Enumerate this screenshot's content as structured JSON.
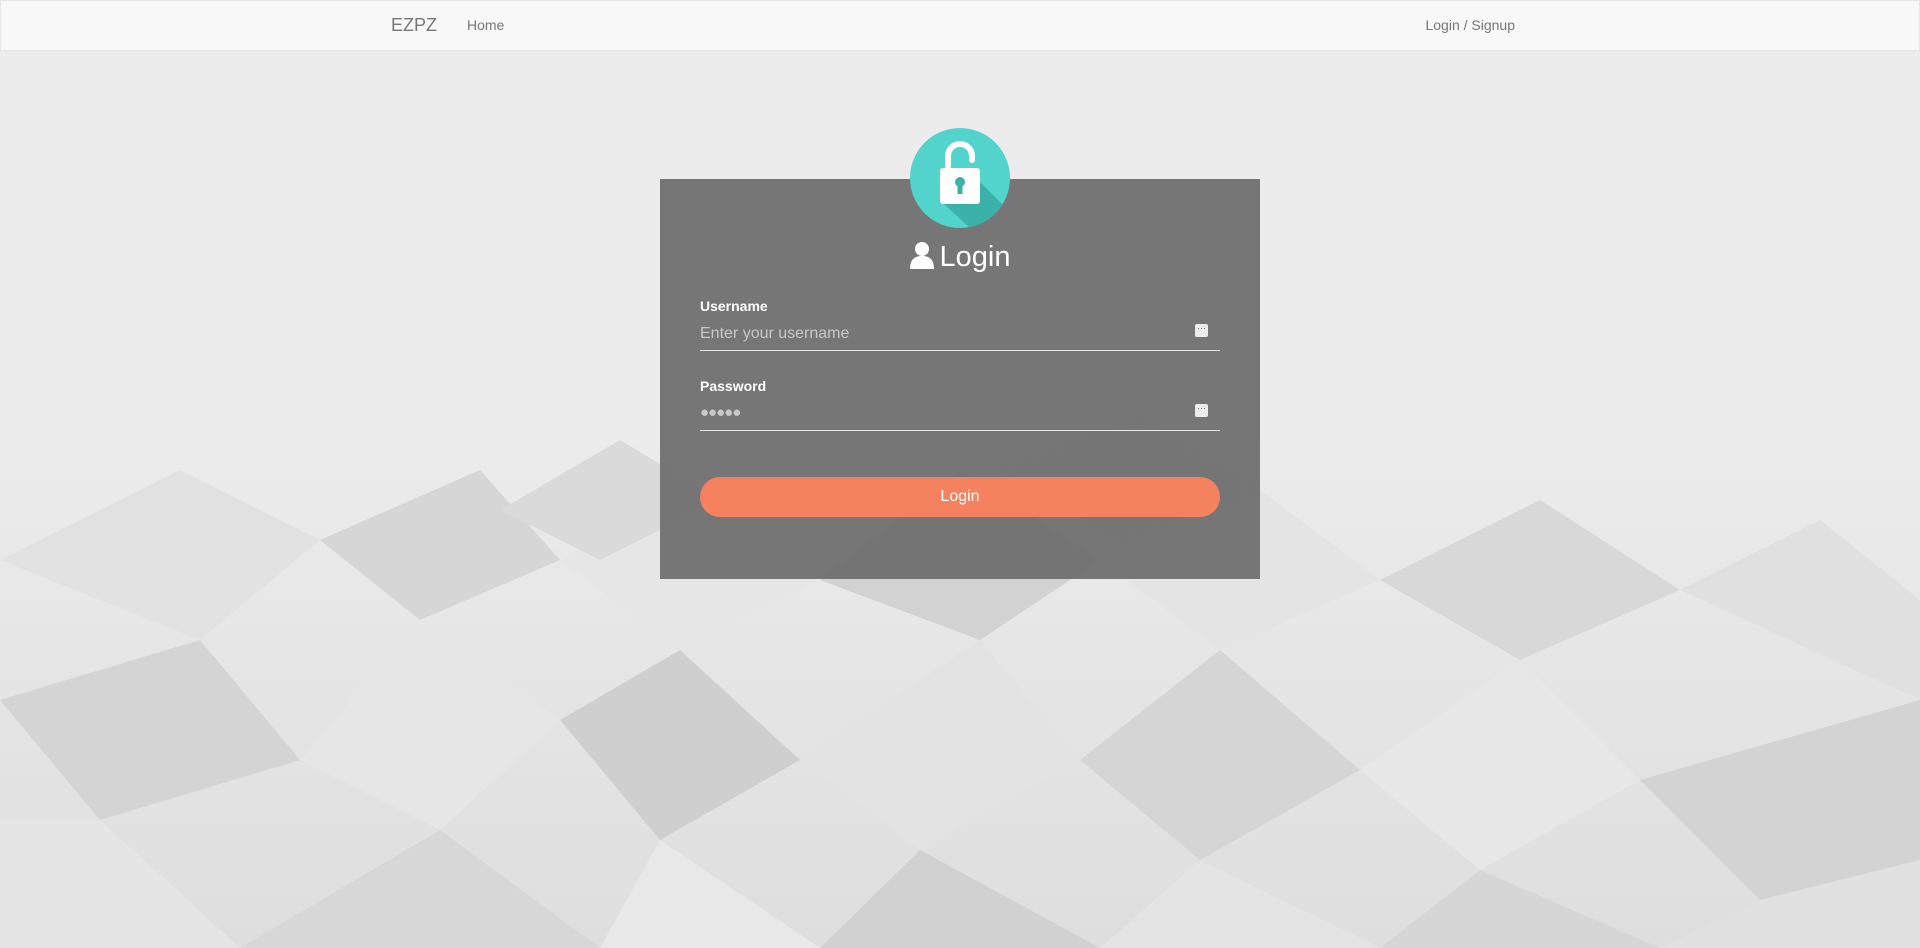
{
  "navbar": {
    "brand": "EZPZ",
    "home_label": "Home",
    "login_signup_label": "Login / Signup"
  },
  "login_form": {
    "title": "Login",
    "username": {
      "label": "Username",
      "placeholder": "Enter your username",
      "value": ""
    },
    "password": {
      "label": "Password",
      "masked_value": "●●●●●"
    },
    "submit_label": "Login"
  },
  "colors": {
    "navbar_bg": "#f8f8f8",
    "card_bg": "#6e6e6e",
    "badge": "#4fd1c5",
    "button": "#f5825e"
  },
  "icons": {
    "badge": "unlocked-padlock-icon",
    "title": "user-icon",
    "field_action": "more-dots-icon"
  }
}
